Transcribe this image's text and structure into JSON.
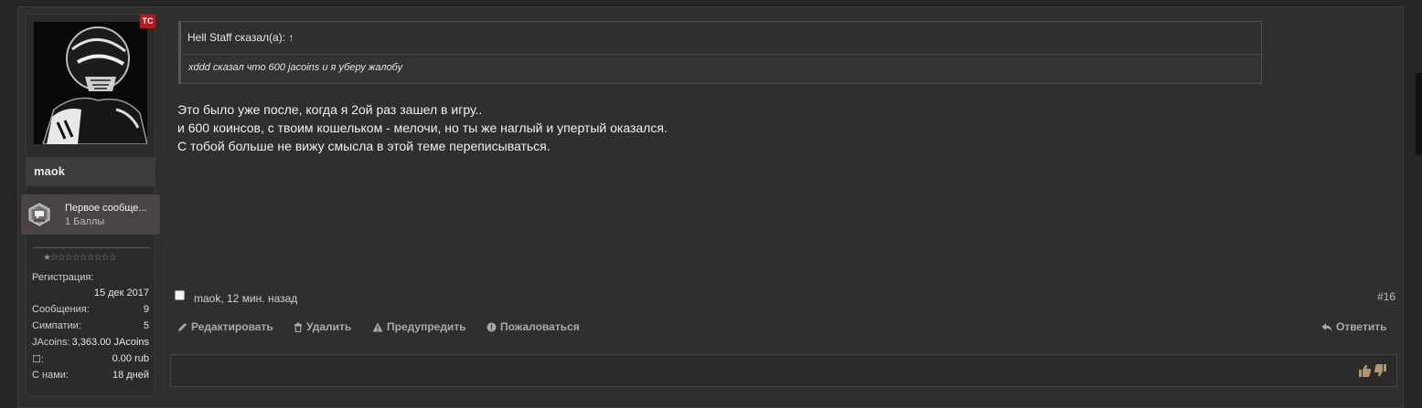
{
  "user": {
    "badge": "ТС",
    "name": "maok",
    "trophy": {
      "title": "Первое сообще...",
      "points": "1 Баллы"
    },
    "stars": "★☆☆☆☆☆☆☆☆☆",
    "stats": [
      {
        "label": "Регистрация:",
        "value": ""
      },
      {
        "label": "",
        "value": "15 дек 2017"
      },
      {
        "label": "Сообщения:",
        "value": "9"
      },
      {
        "label": "Симпатии:",
        "value": "5"
      },
      {
        "label": "JAcoins:",
        "value": "3,363.00 JAcoins"
      },
      {
        "label": "☐:",
        "value": "0.00 rub"
      },
      {
        "label": "С нами:",
        "value": "18 дней"
      }
    ]
  },
  "quote": {
    "header": "Hell Staff сказал(а): ↑",
    "text": "xddd сказал что 600 jacoins и я уберу жалобу"
  },
  "message": {
    "lines": [
      "Это было уже после, когда я 2ой раз зашел в игру..",
      "и 600 коинсов, с твоим кошельком - мелочи, но ты же наглый и упертый оказался.",
      "С тобой больше не вижу смысла в этой теме переписываться."
    ]
  },
  "meta": {
    "author": "maok",
    "time": ", 12 мин. назад",
    "post_number": "#16"
  },
  "actions": {
    "edit": "Редактировать",
    "delete": "Удалить",
    "warn": "Предупредить",
    "report": "Пожаловаться",
    "reply": "Ответить"
  },
  "likes": {
    "icons": "👍👎"
  }
}
